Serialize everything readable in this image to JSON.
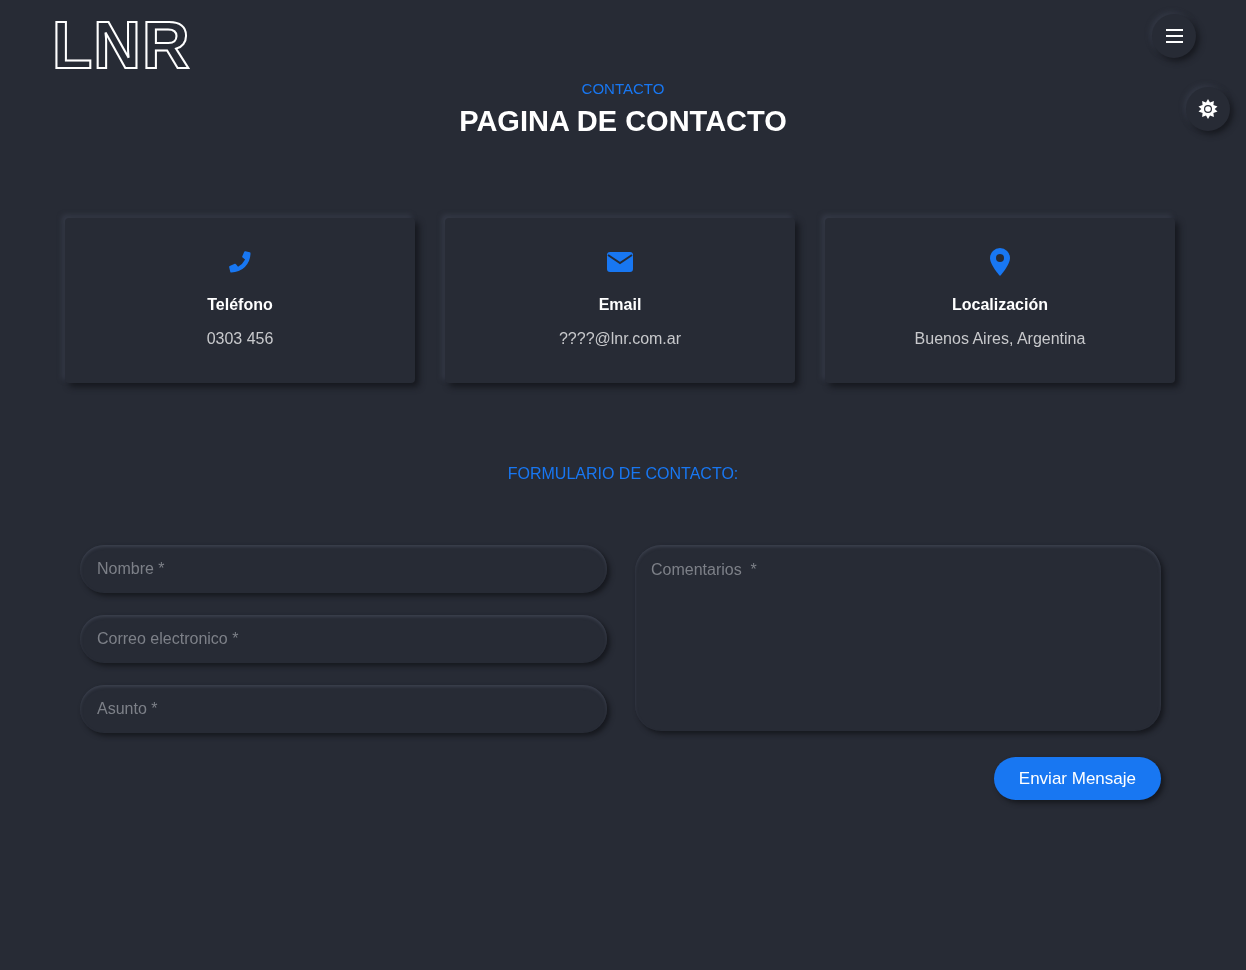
{
  "logo": "LNR",
  "section_label": "CONTACTO",
  "title": "PAGINA DE CONTACTO",
  "cards": [
    {
      "kind": "phone",
      "title": "Teléfono",
      "value": "0303 456"
    },
    {
      "kind": "email",
      "title": "Email",
      "value": "????@lnr.com.ar"
    },
    {
      "kind": "location",
      "title": "Localización",
      "value": "Buenos Aires, Argentina"
    }
  ],
  "form": {
    "heading": "FORMULARIO DE CONTACTO:",
    "fields": [
      {
        "placeholder": "Nombre *"
      },
      {
        "placeholder": "Correo electronico *"
      },
      {
        "placeholder": "Asunto *"
      }
    ],
    "comments": {
      "placeholder": "Comentarios  *"
    },
    "submit": "Enviar Mensaje"
  }
}
